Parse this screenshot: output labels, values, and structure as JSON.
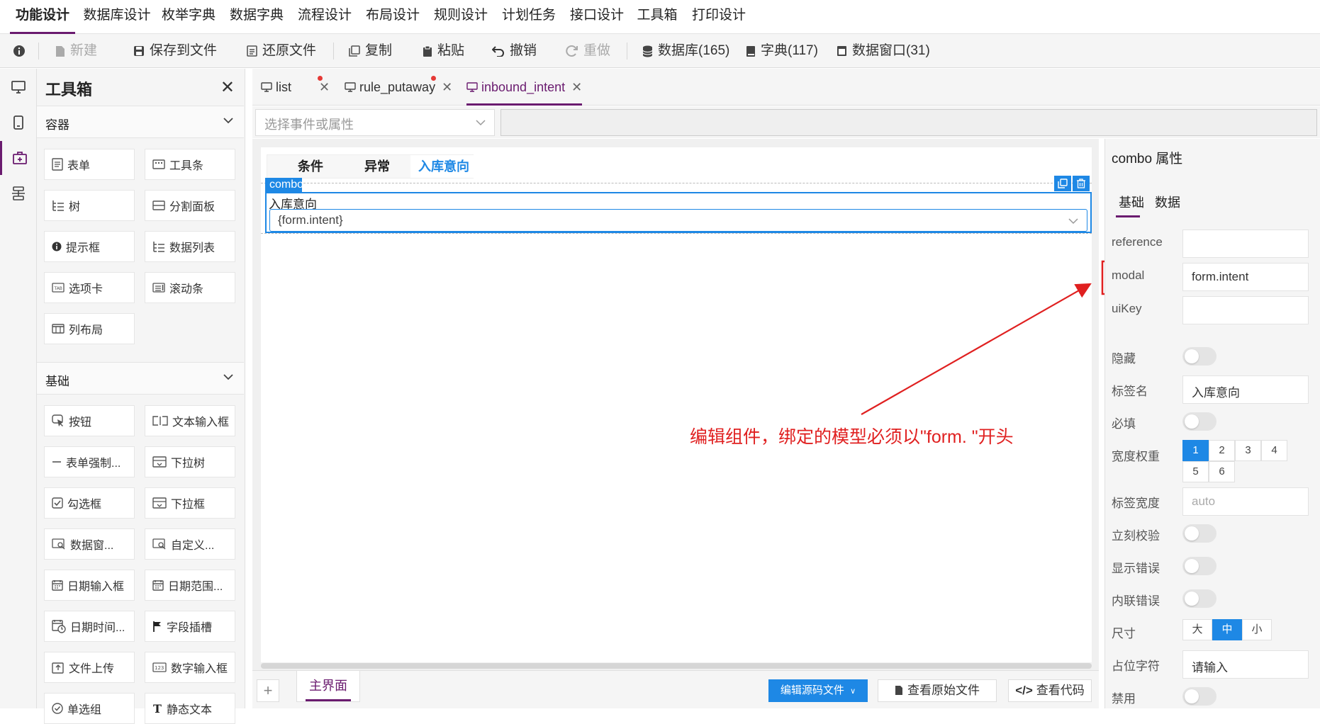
{
  "menu": {
    "items": [
      "功能设计",
      "数据库设计",
      "枚举字典",
      "数据字典",
      "流程设计",
      "布局设计",
      "规则设计",
      "计划任务",
      "接口设计",
      "工具箱",
      "打印设计"
    ],
    "active": "功能设计"
  },
  "toolbar": {
    "new": "新建",
    "save_to_file": "保存到文件",
    "restore_file": "还原文件",
    "copy": "复制",
    "paste": "粘贴",
    "undo": "撤销",
    "redo": "重做",
    "database": "数据库(165)",
    "dictionary": "字典(117)",
    "data_window": "数据窗口(31)"
  },
  "toolbox": {
    "title": "工具箱",
    "containers": {
      "title": "容器",
      "items": [
        "表单",
        "工具条",
        "树",
        "分割面板",
        "提示框",
        "数据列表",
        "选项卡",
        "滚动条",
        "列布局"
      ]
    },
    "basic": {
      "title": "基础",
      "items": [
        "按钮",
        "文本输入框",
        "表单强制...",
        "下拉树",
        "勾选框",
        "下拉框",
        "数据窗...",
        "自定义...",
        "日期输入框",
        "日期范围...",
        "日期时间...",
        "字段插槽",
        "文件上传",
        "数字输入框",
        "单选组",
        "静态文本"
      ]
    }
  },
  "file_tabs": [
    {
      "label": "list",
      "modified": true
    },
    {
      "label": "rule_putaway",
      "modified": true
    },
    {
      "label": "inbound_intent",
      "modified": false,
      "active": true
    }
  ],
  "event_select": {
    "placeholder": "选择事件或属性"
  },
  "canvas": {
    "tabs": [
      "条件",
      "异常",
      "入库意向"
    ],
    "active_tab": "入库意向",
    "selected_tag": "combo",
    "field_label": "入库意向",
    "field_value": "{form.intent}"
  },
  "annotation": {
    "text": "编辑组件，绑定的模型必须以\"form. \"开头",
    "color": "#e02020"
  },
  "bottom": {
    "main_tab": "主界面",
    "edit_source": "编辑源码文件",
    "view_original": "查看原始文件",
    "view_code": "查看代码"
  },
  "props": {
    "title": "combo 属性",
    "tabs": [
      "基础",
      "数据"
    ],
    "active_tab": "基础",
    "reference": {
      "label": "reference",
      "value": ""
    },
    "modal": {
      "label": "modal",
      "value": "form.intent"
    },
    "uiKey": {
      "label": "uiKey",
      "value": ""
    },
    "hidden": {
      "label": "隐藏",
      "on": false
    },
    "label_name": {
      "label": "标签名",
      "value": "入库意向"
    },
    "required": {
      "label": "必填",
      "on": false
    },
    "width_weight": {
      "label": "宽度权重",
      "options": [
        "1",
        "2",
        "3",
        "4",
        "5",
        "6"
      ],
      "selected": "1"
    },
    "label_width": {
      "label": "标签宽度",
      "placeholder": "auto"
    },
    "instant_validate": {
      "label": "立刻校验",
      "on": false
    },
    "show_error": {
      "label": "显示错误",
      "on": false
    },
    "inline_error": {
      "label": "内联错误",
      "on": false
    },
    "size": {
      "label": "尺寸",
      "options": [
        "大",
        "中",
        "小"
      ],
      "selected": "中"
    },
    "placeholder": {
      "label": "占位字符",
      "value": "请输入"
    },
    "disabled": {
      "label": "禁用",
      "on": false
    }
  },
  "colors": {
    "brand": "#6a1b6f",
    "accent": "#1e88e5",
    "highlight": "#e02020"
  }
}
